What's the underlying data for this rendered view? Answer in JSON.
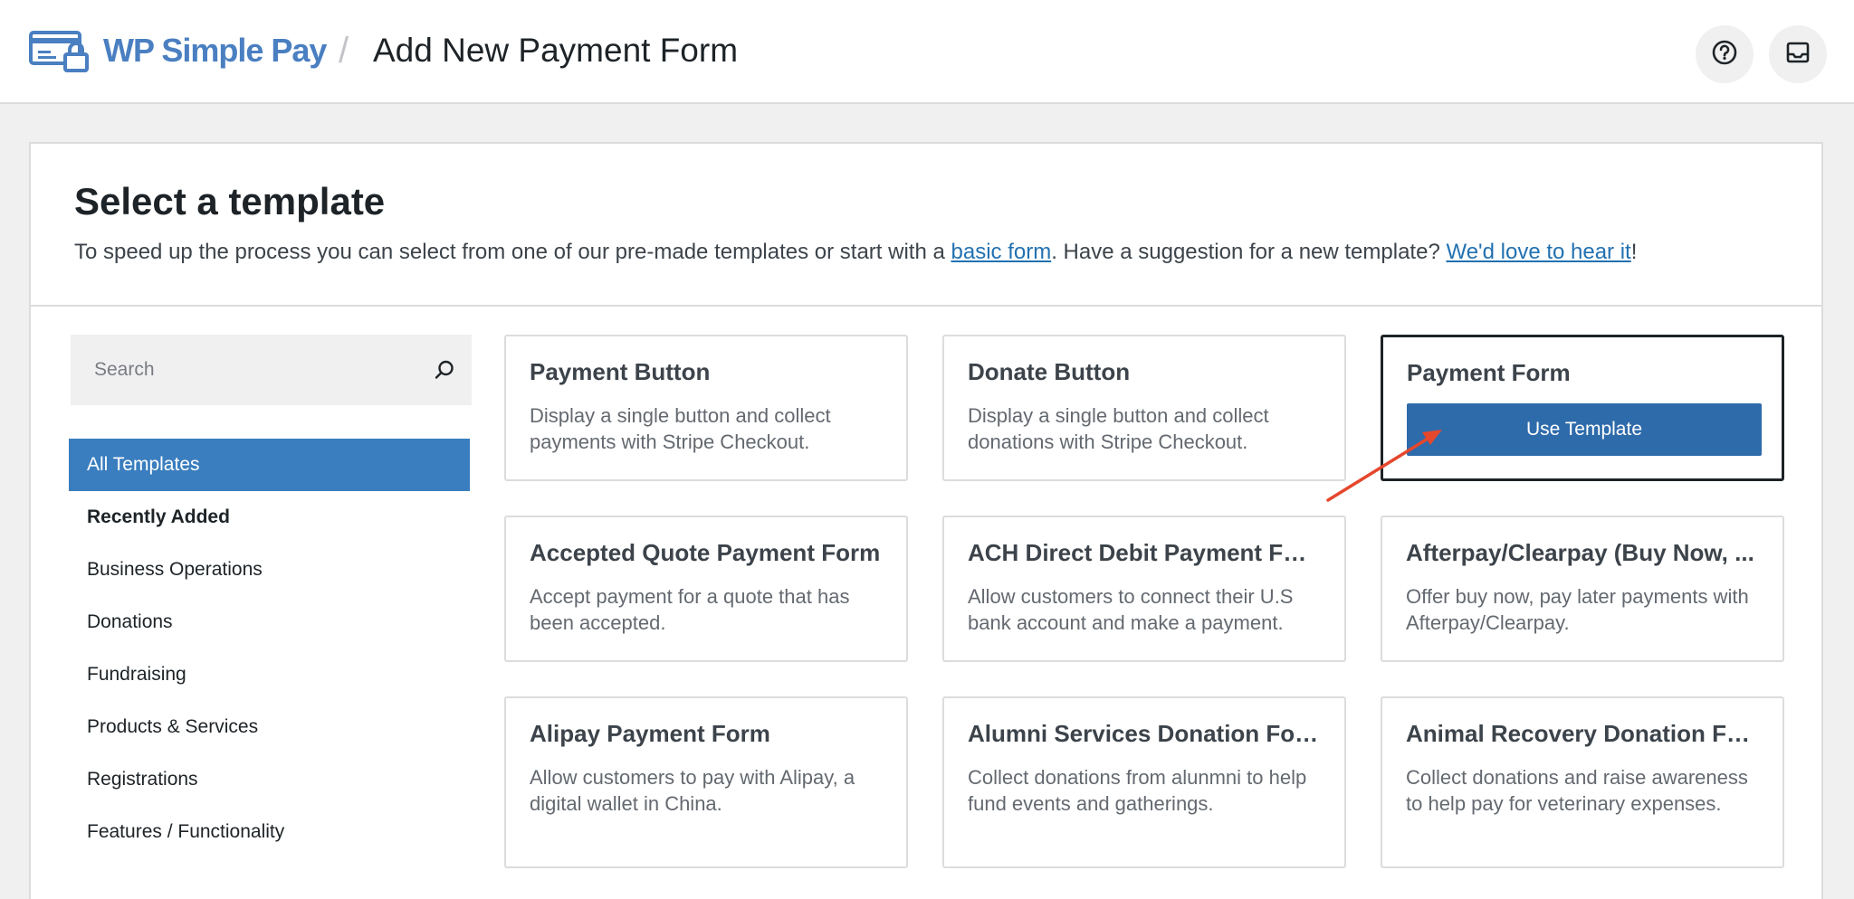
{
  "header": {
    "brand_name": "WP Simple Pay",
    "separator": "/",
    "page_title": "Add New Payment Form",
    "brand_color": "#4a7fc1"
  },
  "intro": {
    "heading": "Select a template",
    "text_before": "To speed up the process you can select from one of our pre-made templates or start with a ",
    "basic_form_link": "basic form",
    "text_middle": ". Have a suggestion for a new template? ",
    "suggest_link": "We'd love to hear it",
    "text_after": "!"
  },
  "search": {
    "placeholder": "Search"
  },
  "categories": [
    "All Templates",
    "Recently Added",
    "Business Operations",
    "Donations",
    "Fundraising",
    "Products & Services",
    "Registrations",
    "Features / Functionality"
  ],
  "templates": [
    {
      "title": "Payment Button",
      "description": "Display a single button and collect payments with Stripe Checkout."
    },
    {
      "title": "Donate Button",
      "description": "Display a single button and collect donations with Stripe Checkout."
    },
    {
      "title": "Payment Form",
      "button": "Use Template"
    },
    {
      "title": "Accepted Quote Payment Form",
      "description": "Accept payment for a quote that has been accepted."
    },
    {
      "title": "ACH Direct Debit Payment Form",
      "description": "Allow customers to connect their U.S bank account and make a payment."
    },
    {
      "title": "Afterpay/Clearpay (Buy Now, ...",
      "description": "Offer buy now, pay later payments with Afterpay/Clearpay."
    },
    {
      "title": "Alipay Payment Form",
      "description": "Allow customers to pay with Alipay, a digital wallet in China."
    },
    {
      "title": "Alumni Services Donation Form",
      "description": "Collect donations from alunmni to help fund events and gatherings."
    },
    {
      "title": "Animal Recovery Donation Form",
      "description": "Collect donations and raise awareness to help pay for veterinary expenses."
    }
  ],
  "colors": {
    "accent": "#3a7ebf",
    "button": "#2e6bab",
    "link": "#2271b1",
    "annotation_arrow": "#e5472d"
  },
  "icons": [
    "help-icon",
    "inbox-icon",
    "search-icon"
  ]
}
